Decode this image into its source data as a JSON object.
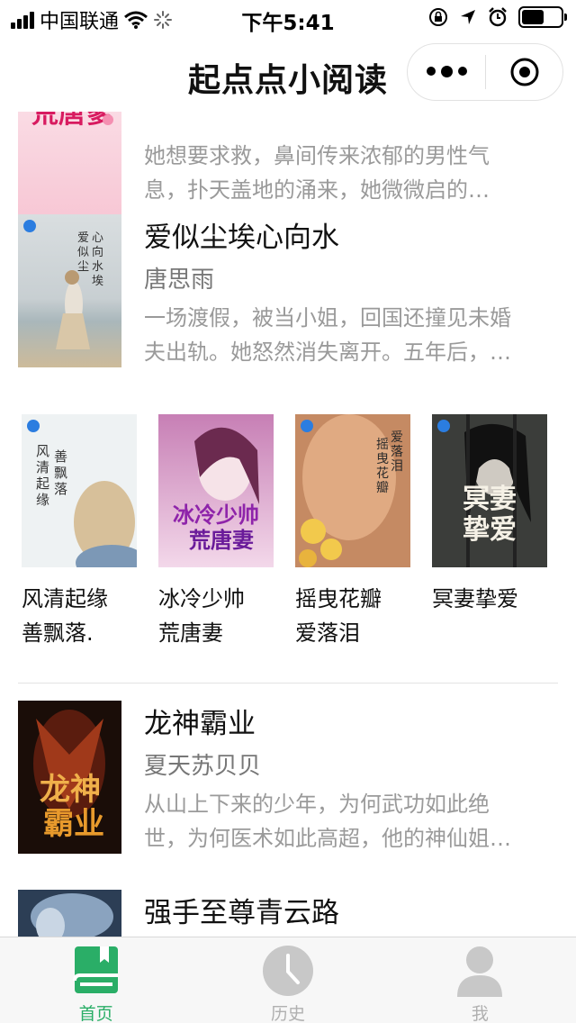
{
  "status_bar": {
    "carrier": "中国联通",
    "time": "下午5:41"
  },
  "nav": {
    "title": "起点点小阅读"
  },
  "books": [
    {
      "cover_text": "贴心明玉 荒唐爹",
      "title": "",
      "author": "",
      "desc": [
        "她想要求救，鼻间传来浓郁的男性气",
        "息，扑天盖地的涌来，她微微启的…"
      ]
    },
    {
      "cover_text": "爱似尘埃心向水",
      "title": "爱似尘埃心向水",
      "author": "唐思雨",
      "desc": [
        "一场渡假，被当小姐，回国还撞见未婚",
        "夫出轨。她怒然消失离开。五年后，…"
      ]
    }
  ],
  "grid": [
    {
      "name": "风清起缘善飘落.",
      "lines": [
        "风清起缘",
        "善飘落."
      ],
      "cover_text": "风清起缘 善飘落"
    },
    {
      "name": "冰冷少帅荒唐妻",
      "lines": [
        "冰冷少帅",
        "荒唐妻"
      ],
      "cover_text": "冰冷少帅 荒唐妻"
    },
    {
      "name": "摇曳花瓣爱落泪",
      "lines": [
        "摇曳花瓣",
        "爱落泪"
      ],
      "cover_text": "爱落泪 摇曳花瓣"
    },
    {
      "name": "冥妻挚爱",
      "lines": [
        "冥妻挚爱"
      ],
      "cover_text": "冥妻 挚爱"
    }
  ],
  "more_books": [
    {
      "cover_text": "龙神 霸业",
      "title": "龙神霸业",
      "author": "夏天苏贝贝",
      "desc": [
        "从山上下来的少年，为何武功如此绝",
        "世，为何医术如此高超，他的神仙姐…"
      ]
    },
    {
      "title": "强手至尊青云路",
      "author": "",
      "desc": []
    }
  ],
  "tabs": [
    {
      "label": "首页",
      "icon": "book-icon",
      "active": true
    },
    {
      "label": "历史",
      "icon": "clock-icon",
      "active": false
    },
    {
      "label": "我",
      "icon": "user-icon",
      "active": false
    }
  ],
  "colors": {
    "accent": "#2aae67",
    "tab_inactive": "#b0b0b0",
    "desc_text": "#9a9a9a",
    "author_text": "#777777"
  }
}
